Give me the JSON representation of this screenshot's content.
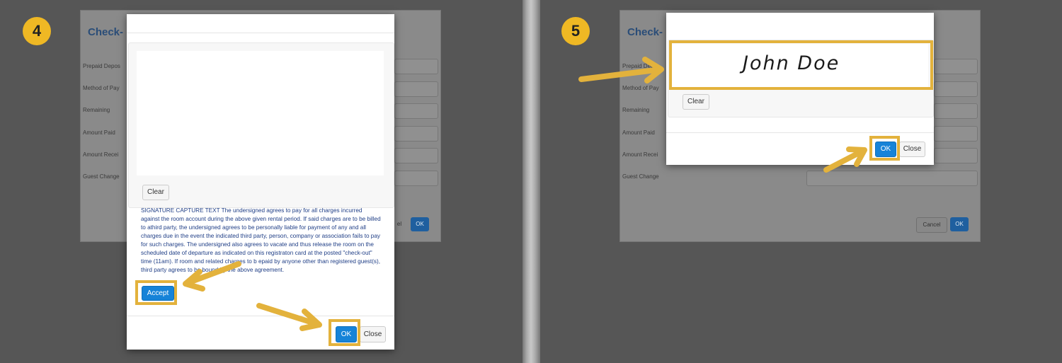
{
  "steps": {
    "left": "4",
    "right": "5"
  },
  "background_form": {
    "title": "Check-",
    "labels_left": [
      "Prepaid Depos",
      "Method of Pay",
      "Remaining",
      "Amount Paid",
      "Amount Recei",
      "Guest Change"
    ],
    "labels_right": [
      "Prepaid Depos",
      "Method of Pay",
      "Remaining",
      "Amount Paid",
      "Amount Recei",
      "Guest Change"
    ],
    "ok_label": "OK",
    "cancel_label": "Cancel",
    "cancel_partial": "el"
  },
  "left_modal": {
    "clear_label": "Clear",
    "signature_text": "SIGNATURE CAPTURE TEXT The undersigned agrees to pay for all charges incurred against the room account during the above given rental period. If said charges are to be billed to athird party, the undersigned agrees to be personally liable for payment of any and all charges due in the event the indicated third party, person, company or association fails to pay for such charges. The undersigned also agrees to vacate and thus release the room on the scheduled date of departure as indicated on this registraton card at the posted \"check-out\" time (11am). If room and related charges to b epaid by anyone other than registered guest(s), third party agrees to be bound by the above agreement.",
    "accept_label": "Accept",
    "ok_label": "OK",
    "close_label": "Close"
  },
  "right_modal": {
    "signature": "John Doe",
    "clear_label": "Clear",
    "ok_label": "OK",
    "close_label": "Close"
  },
  "colors": {
    "highlight": "#e3b23c",
    "arrow": "#e3b23c",
    "step_badge": "#efb824",
    "primary_button": "#1683d8",
    "signature_text": "#1f3e86"
  }
}
